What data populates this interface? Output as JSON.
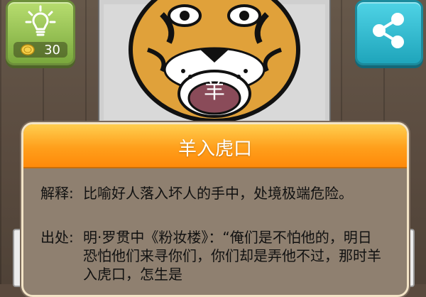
{
  "hint": {
    "icon": "lightbulb-icon",
    "coin_icon": "coin-icon",
    "coins": "30"
  },
  "share": {
    "icon": "share-icon"
  },
  "picture": {
    "mouth_char": "羊",
    "image": "tiger-face"
  },
  "dialog": {
    "title": "羊入虎口",
    "explanation_label": "解释:",
    "explanation_text": "比喻好人落入坏人的手中，处境极端危险。",
    "source_label": "出处:",
    "source_text": "明·罗贯中《粉妆楼》：“俺们是不怕他的，明日恐怕他们来寻你们，你们却是弄他不过，那时羊入虎口，怎生是"
  },
  "colors": {
    "header": "#ff9f1b",
    "dialog_bg": "#8f8070",
    "hint_green": "#8bbb48",
    "share_blue": "#2bb7cc"
  }
}
